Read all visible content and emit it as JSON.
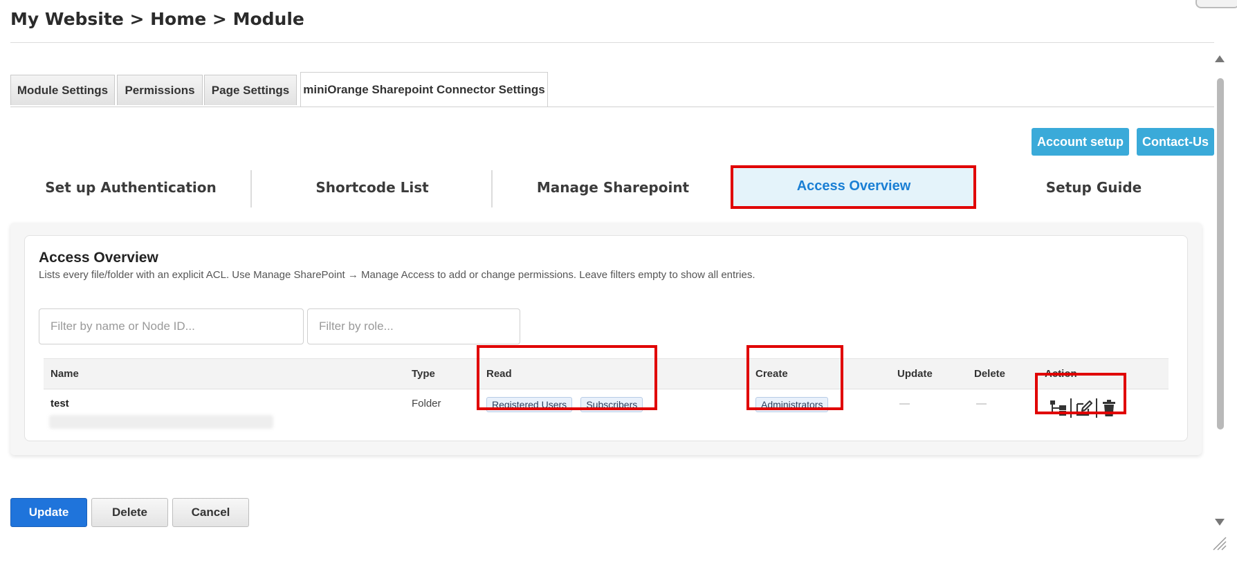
{
  "breadcrumb": "My Website > Home > Module",
  "module_tabs": [
    {
      "label": "Module Settings",
      "active": false
    },
    {
      "label": "Permissions",
      "active": false
    },
    {
      "label": "Page Settings",
      "active": false
    },
    {
      "label": "miniOrange Sharepoint Connector Settings",
      "active": true
    }
  ],
  "top_buttons": {
    "account_setup": "Account setup",
    "contact_us": "Contact-Us"
  },
  "nav_tabs": [
    {
      "label": "Set up Authentication",
      "active": false
    },
    {
      "label": "Shortcode List",
      "active": false
    },
    {
      "label": "Manage Sharepoint",
      "active": false
    },
    {
      "label": "Access Overview",
      "active": true
    },
    {
      "label": "Setup Guide",
      "active": false
    }
  ],
  "access_overview": {
    "title": "Access Overview",
    "description": "Lists every file/folder with an explicit ACL. Use Manage SharePoint → Manage Access to add or change permissions. Leave filters empty to show all entries.",
    "filter_name_placeholder": "Filter by name or Node ID...",
    "filter_role_placeholder": "Filter by role...",
    "columns": [
      "Name",
      "Type",
      "Read",
      "Create",
      "Update",
      "Delete",
      "Action"
    ],
    "rows": [
      {
        "name": "test",
        "type": "Folder",
        "read": [
          "Registered Users",
          "Subscribers"
        ],
        "create": [
          "Administrators"
        ],
        "update": "—",
        "delete": "—",
        "actions": [
          "tree-view-icon",
          "edit-icon",
          "trash-icon"
        ]
      }
    ]
  },
  "footer_buttons": {
    "update": "Update",
    "delete": "Delete",
    "cancel": "Cancel"
  },
  "colors": {
    "accent_blue": "#3aaad9",
    "primary_button": "#1f74db",
    "highlight": "#e00000",
    "active_tab_text": "#1a7fd4",
    "active_tab_bg": "#e4f3fa"
  }
}
